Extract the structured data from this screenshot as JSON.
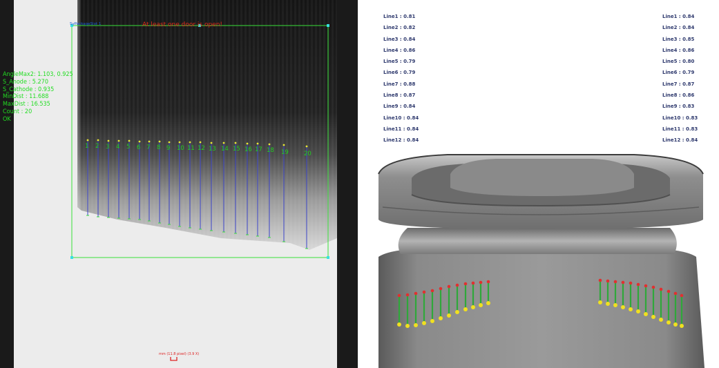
{
  "left_panel": {
    "roi_name": "SyPackageSlot 1",
    "warning": "At least one door is open!",
    "readout": [
      "AngleMax2: 1.103, 0.925",
      "S_Anode : 5.270",
      "S_Cathode : 0.935",
      "MinDist : 11.688",
      "MaxDist : 16.535",
      "Count : 20",
      "OK"
    ],
    "line_labels": [
      "1",
      "2",
      "3",
      "4",
      "5",
      "6",
      "7",
      "8",
      "9",
      "10",
      "11",
      "12",
      "13",
      "14",
      "15",
      "16",
      "17",
      "18",
      "19",
      "20"
    ],
    "scale_text": "mm (11.8 pixel) (3.9 X)",
    "colors": {
      "roi": "#38e038",
      "anode_dot": "#e8e832",
      "cathode_line": "#3b44c8",
      "text_ok": "#22dd22",
      "warning": "#e02a1a"
    }
  },
  "right_panel": {
    "left_measurements": [
      "Line1 : 0.81",
      "Line2 : 0.82",
      "Line3 : 0.84",
      "Line4 : 0.86",
      "Line5 : 0.79",
      "Line6 : 0.79",
      "Line7 : 0.88",
      "Line8 : 0.87",
      "Line9 : 0.84",
      "Line10 : 0.84",
      "Line11 : 0.84",
      "Line12 : 0.84"
    ],
    "right_measurements": [
      "Line1 : 0.84",
      "Line2 : 0.84",
      "Line3 : 0.85",
      "Line4 : 0.86",
      "Line5 : 0.80",
      "Line6 : 0.79",
      "Line7 : 0.87",
      "Line8 : 0.86",
      "Line9 : 0.83",
      "Line10 : 0.83",
      "Line11 : 0.83",
      "Line12 : 0.84"
    ],
    "colors": {
      "text": "#2f3a6e",
      "top_dot": "#e03030",
      "bottom_dot": "#f0e020",
      "connector": "#2fa83a"
    }
  }
}
